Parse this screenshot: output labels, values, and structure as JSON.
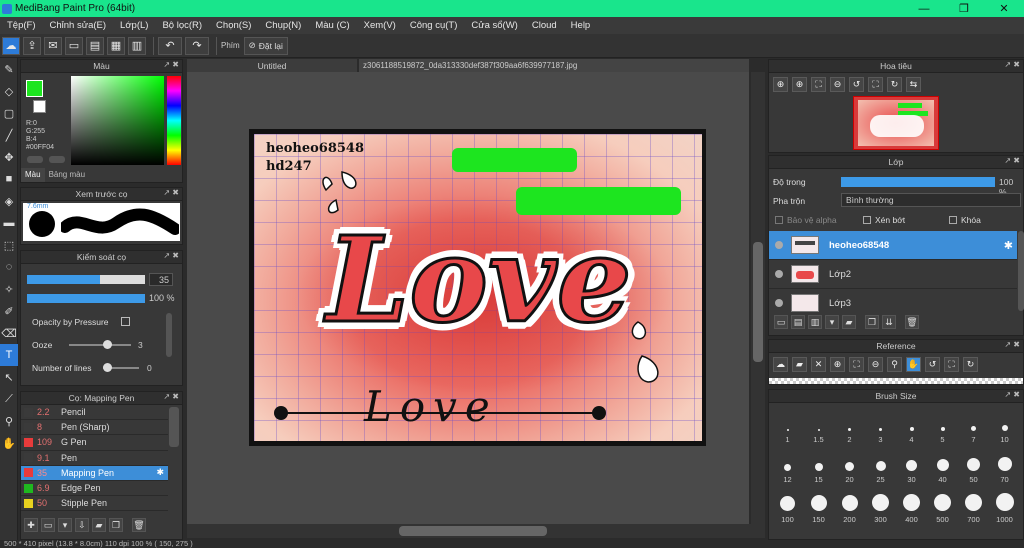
{
  "window": {
    "title": "MediBang Paint Pro (64bit)",
    "minimize": "—",
    "restore": "❐",
    "close": "✕"
  },
  "menu": [
    "Tệp(F)",
    "Chỉnh sửa(E)",
    "Lớp(L)",
    "Bộ lọc(R)",
    "Chọn(S)",
    "Chụp(N)",
    "Màu (C)",
    "Xem(V)",
    "Công cụ(T)",
    "Cửa sổ(W)",
    "Cloud",
    "Help"
  ],
  "toolbar": {
    "shortcut_label": "Phím",
    "reset_label": "Đặt lại"
  },
  "tabs": {
    "untitled": "Untitled",
    "file": "z3061188519872_0da313330def387f309aa6f639977187.jpg"
  },
  "color_panel": {
    "title": "Màu",
    "r": "R:0",
    "g": "G:255",
    "b": "B:4",
    "hex": "#00FF04",
    "tab_color": "Màu",
    "tab_palette": "Bảng màu",
    "primary_color": "#1de51f"
  },
  "preview_panel": {
    "title": "Xem trước cọ",
    "size": "7.6mm"
  },
  "brush_control": {
    "title": "Kiểm soát cọ",
    "size_value": "35",
    "size_fraction": 0.62,
    "opacity_value": "100 %",
    "opacity_fraction": 1.0,
    "pressure_label": "Opacity by Pressure",
    "ooze_label": "Ooze",
    "ooze_value": "3",
    "lines_label": "Number of lines",
    "lines_value": "0"
  },
  "brush_list": {
    "title": "Cọ: Mapping Pen",
    "items": [
      {
        "size": "2.2",
        "name": "Pencil",
        "color": "#3a3a3a"
      },
      {
        "size": "8",
        "name": "Pen (Sharp)",
        "color": "#3a3a3a"
      },
      {
        "size": "109",
        "name": "G Pen",
        "color": "#e83b3b"
      },
      {
        "size": "9.1",
        "name": "Pen",
        "color": "#3a3a3a"
      },
      {
        "size": "35",
        "name": "Mapping Pen",
        "color": "#e83b3b"
      },
      {
        "size": "6.9",
        "name": "Edge Pen",
        "color": "#1fb81f"
      },
      {
        "size": "50",
        "name": "Stipple Pen",
        "color": "#e8d21f"
      }
    ]
  },
  "artwork": {
    "line1": "heoheo68548",
    "line2": "hd247",
    "word_big": "Love",
    "word_small": "Love"
  },
  "navigator": {
    "title": "Hoa tiêu"
  },
  "layer_panel": {
    "title": "Lớp",
    "opacity_label": "Độ trong",
    "opacity_value": "100 %",
    "opacity_fraction": 1.0,
    "blend_label": "Pha trộn",
    "blend_value": "Bình thường",
    "protect_alpha": "Bảo vệ alpha",
    "clipping": "Xén bớt",
    "lock": "Khóa",
    "layers": [
      {
        "name": "heoheo68548",
        "selected": true
      },
      {
        "name": "Lớp2",
        "selected": false
      },
      {
        "name": "Lớp3",
        "selected": false
      }
    ]
  },
  "reference_panel": {
    "title": "Reference"
  },
  "brush_size_panel": {
    "title": "Brush Size",
    "sizes": [
      "1",
      "1.5",
      "2",
      "3",
      "4",
      "5",
      "7",
      "10",
      "12",
      "15",
      "20",
      "25",
      "30",
      "40",
      "50",
      "70",
      "100",
      "150",
      "200",
      "300",
      "400",
      "500",
      "700",
      "1000"
    ]
  },
  "status": {
    "text": "500 * 410 pixel   (13.8 * 8.0cm)   110 dpi   100 %   ( 150, 275 )"
  }
}
